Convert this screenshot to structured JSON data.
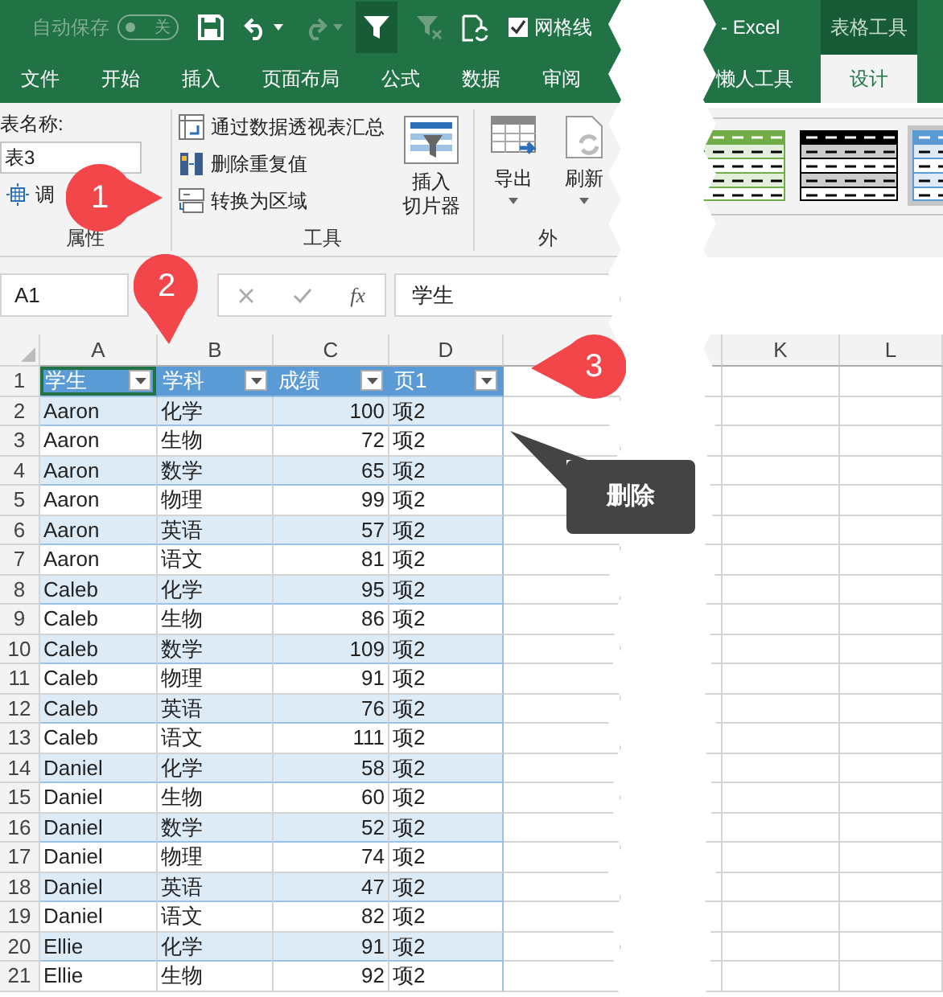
{
  "title_bar": {
    "autosave": "自动保存",
    "autosave_toggle": {
      "label": "关",
      "on": false
    },
    "filter_on": true,
    "gridlines": {
      "label": "网格线",
      "checked": true
    },
    "app_title": "- Excel",
    "context_tab": "表格工具"
  },
  "tabs": [
    {
      "label": "文件",
      "selected": false
    },
    {
      "label": "开始",
      "selected": false
    },
    {
      "label": "插入",
      "selected": false
    },
    {
      "label": "页面布局",
      "selected": false
    },
    {
      "label": "公式",
      "selected": false
    },
    {
      "label": "数据",
      "selected": false
    },
    {
      "label": "审阅",
      "selected": false
    }
  ],
  "right_tabs": [
    {
      "label": "懒人工具",
      "selected": false
    },
    {
      "label": "设计",
      "selected": true
    }
  ],
  "ribbon": {
    "properties": {
      "name_label": "表名称:",
      "name_value": "表3",
      "resize": "调",
      "label": "属性"
    },
    "tools": {
      "commands": [
        "通过数据透视表汇总",
        "删除重复值",
        "转换为区域"
      ],
      "slicer": [
        "插入",
        "切片器"
      ],
      "label": "工具"
    },
    "external": {
      "buttons": [
        "导出",
        "刷新"
      ],
      "label": "外"
    },
    "table_styles": [
      {
        "color": "#70ad47",
        "selected": false
      },
      {
        "color": "#000000",
        "selected": false
      },
      {
        "color": "#5b9bd5",
        "selected": true
      }
    ]
  },
  "formula_bar": {
    "name_box": "A1",
    "fx_label": "fx",
    "formula": "学生"
  },
  "sheet": {
    "columns": [
      "A",
      "B",
      "C",
      "D"
    ],
    "right_columns": [
      "K",
      "L"
    ],
    "header": {
      "number": "1",
      "cells": [
        {
          "text": "学生",
          "selected": true
        },
        {
          "text": "学科",
          "selected": false
        },
        {
          "text": "成绩",
          "selected": false
        },
        {
          "text": "页1",
          "selected": false
        }
      ]
    },
    "rows": [
      {
        "number": "2",
        "cells": [
          "Aaron",
          "化学",
          "100",
          "项2"
        ]
      },
      {
        "number": "3",
        "cells": [
          "Aaron",
          "生物",
          "72",
          "项2"
        ]
      },
      {
        "number": "4",
        "cells": [
          "Aaron",
          "数学",
          "65",
          "项2"
        ]
      },
      {
        "number": "5",
        "cells": [
          "Aaron",
          "物理",
          "99",
          "项2"
        ]
      },
      {
        "number": "6",
        "cells": [
          "Aaron",
          "英语",
          "57",
          "项2"
        ]
      },
      {
        "number": "7",
        "cells": [
          "Aaron",
          "语文",
          "81",
          "项2"
        ]
      },
      {
        "number": "8",
        "cells": [
          "Caleb",
          "化学",
          "95",
          "项2"
        ]
      },
      {
        "number": "9",
        "cells": [
          "Caleb",
          "生物",
          "86",
          "项2"
        ]
      },
      {
        "number": "10",
        "cells": [
          "Caleb",
          "数学",
          "109",
          "项2"
        ]
      },
      {
        "number": "11",
        "cells": [
          "Caleb",
          "物理",
          "91",
          "项2"
        ]
      },
      {
        "number": "12",
        "cells": [
          "Caleb",
          "英语",
          "76",
          "项2"
        ]
      },
      {
        "number": "13",
        "cells": [
          "Caleb",
          "语文",
          "111",
          "项2"
        ]
      },
      {
        "number": "14",
        "cells": [
          "Daniel",
          "化学",
          "58",
          "项2"
        ]
      },
      {
        "number": "15",
        "cells": [
          "Daniel",
          "生物",
          "60",
          "项2"
        ]
      },
      {
        "number": "16",
        "cells": [
          "Daniel",
          "数学",
          "52",
          "项2"
        ]
      },
      {
        "number": "17",
        "cells": [
          "Daniel",
          "物理",
          "74",
          "项2"
        ]
      },
      {
        "number": "18",
        "cells": [
          "Daniel",
          "英语",
          "47",
          "项2"
        ]
      },
      {
        "number": "19",
        "cells": [
          "Daniel",
          "语文",
          "82",
          "项2"
        ]
      },
      {
        "number": "20",
        "cells": [
          "Ellie",
          "化学",
          "91",
          "项2"
        ]
      },
      {
        "number": "21",
        "cells": [
          "Ellie",
          "生物",
          "92",
          "项2"
        ]
      }
    ]
  },
  "callouts": [
    "1",
    "2",
    "3"
  ],
  "tooltip": "删除"
}
